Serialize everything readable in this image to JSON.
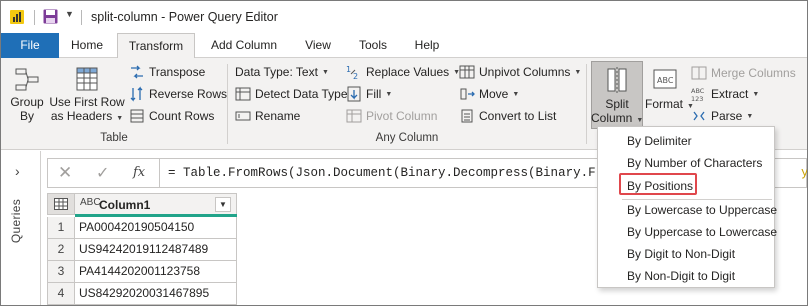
{
  "window": {
    "title": "split-column - Power Query Editor"
  },
  "tabs": [
    "File",
    "Home",
    "Transform",
    "Add Column",
    "View",
    "Tools",
    "Help"
  ],
  "active_tab": "Transform",
  "ribbon": {
    "table_group": {
      "label": "Table",
      "group_by": [
        "Group",
        "By"
      ],
      "first_row": [
        "Use First Row",
        "as Headers"
      ],
      "transpose": "Transpose",
      "reverse_rows": "Reverse Rows",
      "count_rows": "Count Rows"
    },
    "any_column_group": {
      "label": "Any Column",
      "data_type": "Data Type: Text",
      "detect_data_type": "Detect Data Type",
      "rename": "Rename",
      "replace_values": "Replace Values",
      "fill": "Fill",
      "pivot_column": "Pivot Column",
      "unpivot_columns": "Unpivot Columns",
      "move": "Move",
      "convert_to_list": "Convert to List"
    },
    "text_group": {
      "split_column": [
        "Split",
        "Column"
      ],
      "format": "Format",
      "merge_columns": "Merge Columns",
      "extract": "Extract",
      "parse": "Parse"
    }
  },
  "queries_pane": {
    "label": "Queries"
  },
  "formula_bar": {
    "fx": "fx",
    "formula": "= Table.FromRows(Json.Document(Binary.Decompress(Binary.FromText",
    "tail": "yPu"
  },
  "grid": {
    "column_type": "ABC",
    "column_name": "Column1",
    "rows": [
      {
        "n": "1",
        "value": "PA000420190504150"
      },
      {
        "n": "2",
        "value": "US94242019112487489"
      },
      {
        "n": "3",
        "value": "PA4144202001123758"
      },
      {
        "n": "4",
        "value": "US84292020031467895"
      }
    ]
  },
  "split_menu": {
    "items": [
      "By Delimiter",
      "By Number of Characters",
      "By Positions",
      "By Lowercase to Uppercase",
      "By Uppercase to Lowercase",
      "By Digit to Non-Digit",
      "By Non-Digit to Digit"
    ],
    "highlighted": "By Positions"
  },
  "colors": {
    "file_tab": "#1f6fb7",
    "column_quality_bar": "#21a48a",
    "highlight_border": "#e0474c",
    "ribbon_bg": "#f3f2f1"
  }
}
